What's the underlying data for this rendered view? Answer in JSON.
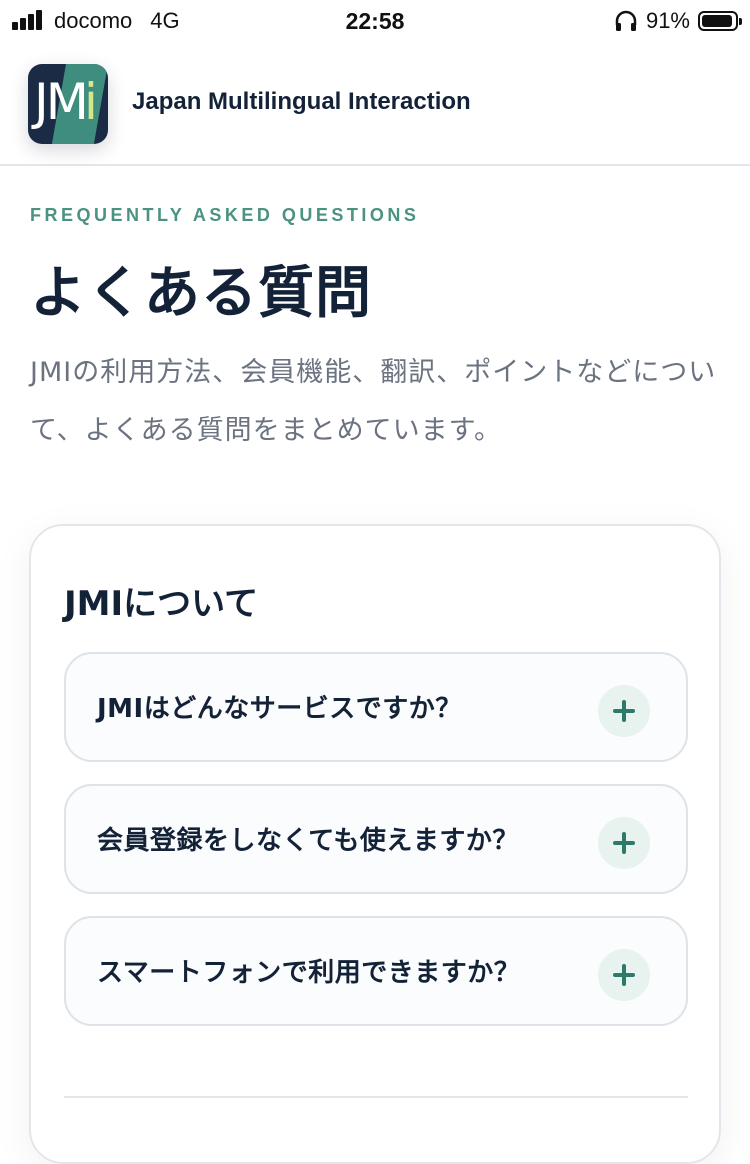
{
  "status_bar": {
    "carrier": "docomo",
    "network": "4G",
    "time": "22:58",
    "battery_percent": "91%"
  },
  "header": {
    "logo_text_main": "JM",
    "logo_text_accent": "i",
    "brand_name": "Japan Multilingual Interaction"
  },
  "hero": {
    "eyebrow": "FREQUENTLY ASKED QUESTIONS",
    "title": "よくある質問",
    "intro": "JMIの利用方法、会員機能、翻訳、ポイントなどについて、よくある質問をまとめています。"
  },
  "faq": {
    "section_title": "JMIについて",
    "questions": [
      {
        "question": "JMIはどんなサービスですか？"
      },
      {
        "question": "会員登録をしなくても使えますか？"
      },
      {
        "question": "スマートフォンで利用できますか？"
      }
    ]
  },
  "colors": {
    "accent": "#4a9383",
    "plus_icon": "#2e7a69",
    "heading": "#142238",
    "body_text": "#6b7380"
  }
}
